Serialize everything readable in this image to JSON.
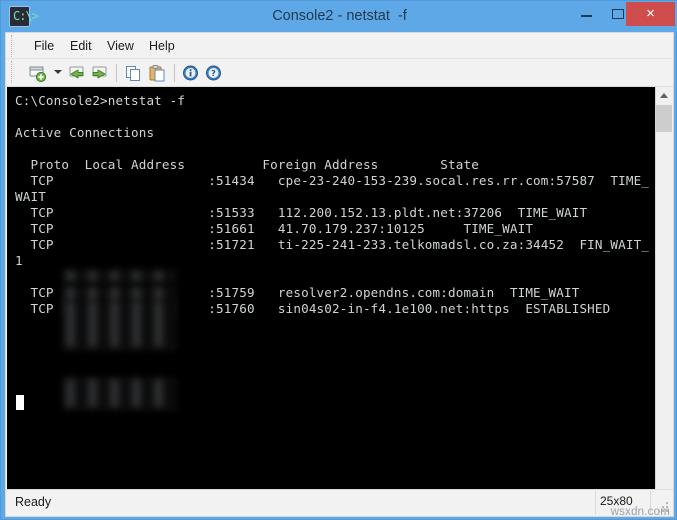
{
  "window": {
    "title": "Console2 - netstat  -f",
    "app_icon": "console-app-icon",
    "icon_glyph": "C:\\>",
    "controls": {
      "minimize": "minimize-button",
      "maximize": "maximize-button",
      "close_label": "×"
    }
  },
  "menubar": {
    "items": [
      {
        "label": "File"
      },
      {
        "label": "Edit"
      },
      {
        "label": "View"
      },
      {
        "label": "Help"
      }
    ]
  },
  "toolbar": {
    "items": [
      {
        "name": "new-tab-icon"
      },
      {
        "name": "new-tab-dropdown-caret"
      },
      {
        "name": "back-arrow-icon"
      },
      {
        "name": "forward-arrow-icon"
      },
      {
        "name": "copy-icon"
      },
      {
        "name": "paste-icon"
      },
      {
        "name": "info-icon"
      },
      {
        "name": "help-icon"
      }
    ]
  },
  "console": {
    "prompt_line": "C:\\Console2>netstat -f",
    "blank_1": "",
    "heading": "Active Connections",
    "blank_2": "",
    "column_header": "  Proto  Local Address          Foreign Address        State",
    "lines": [
      "  TCP                    :51434   cpe-23-240-153-239.socal.res.rr.com:57587  TIME_",
      "WAIT",
      "  TCP                    :51533   112.200.152.13.pldt.net:37206  TIME_WAIT",
      "  TCP                    :51661   41.70.179.237:10125     TIME_WAIT",
      "  TCP                    :51721   ti-225-241-233.telkomadsl.co.za:34452  FIN_WAIT_",
      "1",
      "  TCP                    :51759   resolver2.opendns.com:domain  TIME_WAIT",
      "  TCP                    :51760   sin04s02-in-f4.1e100.net:https  ESTABLISHED"
    ],
    "redacted_note": "local-address-redacted",
    "cursor": "block-cursor",
    "colors": {
      "background": "#000000",
      "foreground": "#cfd4d6"
    }
  },
  "scrollbar": {
    "up_arrow": "scroll-up-arrow",
    "down_arrow": "scroll-down-arrow",
    "thumb": "scroll-thumb"
  },
  "statusbar": {
    "status": "Ready",
    "size": "25x80",
    "watermark": "wsxdn.com"
  },
  "theme": {
    "titlebar": "#5fa8e8",
    "close_button": "#cf4d4d",
    "chrome": "#f2f2f2"
  }
}
